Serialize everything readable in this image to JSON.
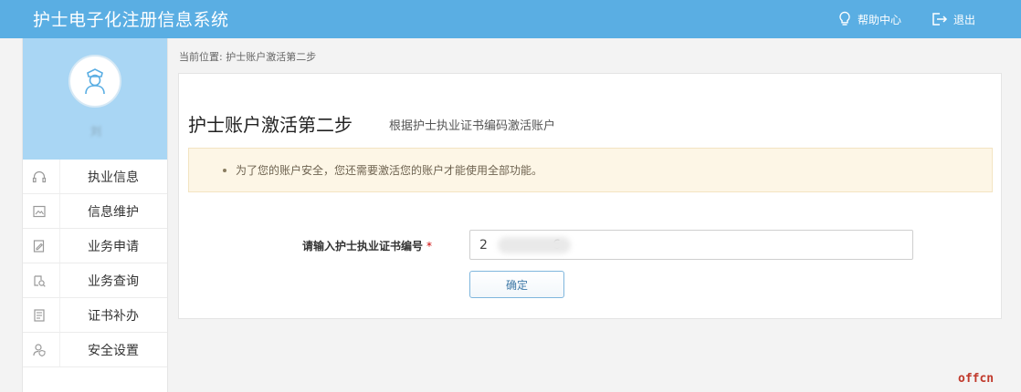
{
  "header": {
    "title": "护士电子化注册信息系统",
    "help_label": "帮助中心",
    "logout_label": "退出"
  },
  "sidebar": {
    "username": "刘",
    "items": [
      {
        "label": "执业信息",
        "icon": "headset-icon"
      },
      {
        "label": "信息维护",
        "icon": "image-icon"
      },
      {
        "label": "业务申请",
        "icon": "form-edit-icon"
      },
      {
        "label": "业务查询",
        "icon": "search-doc-icon"
      },
      {
        "label": "证书补办",
        "icon": "certificate-icon"
      },
      {
        "label": "安全设置",
        "icon": "user-shield-icon"
      }
    ]
  },
  "breadcrumb": "当前位置: 护士账户激活第二步",
  "main": {
    "title": "护士账户激活第二步",
    "subtitle": "根据护士执业证书编码激活账户",
    "notice": "为了您的账户安全，您还需要激活您的账户才能使用全部功能。",
    "form": {
      "label": "请输入护士执业证书编号",
      "required_mark": "*",
      "value": "2                6",
      "confirm_label": "确定"
    }
  },
  "watermark": "offcn",
  "colors": {
    "topbar": "#5aaee3",
    "profile": "#a9d6f4",
    "notice_bg": "#fdf6e6",
    "button_border": "#7fb6dd",
    "watermark": "#c0392b"
  }
}
